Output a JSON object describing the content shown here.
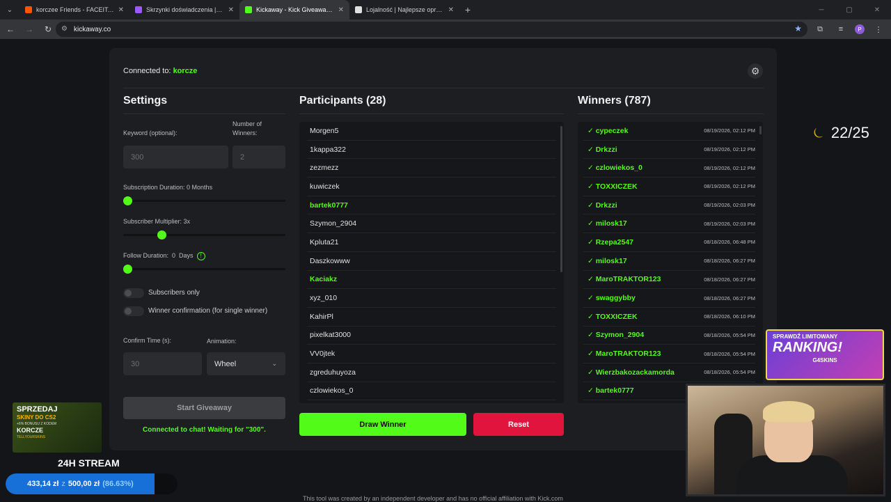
{
  "browser": {
    "tabs": [
      {
        "title": "korczee Friends - FACEIT.com",
        "color": "#ff5500",
        "active": false
      },
      {
        "title": "Skrzynki doświadczenia | G4Skins",
        "color": "#9b59ff",
        "active": false
      },
      {
        "title": "Kickaway - Kick Giveaway Tool",
        "color": "#53fc18",
        "active": true
      },
      {
        "title": "Lojalność | Najlepsze oprogram...",
        "color": "#e0e0e0",
        "active": false
      }
    ],
    "url": "kickaway.co",
    "profile_initial": "P"
  },
  "app": {
    "connected_label": "Connected to:",
    "connected_user": "korcze",
    "settings": {
      "title": "Settings",
      "keyword_label": "Keyword (optional):",
      "keyword_value": "300",
      "winners_label_1": "Number of",
      "winners_label_2": "Winners:",
      "winners_value": "2",
      "sub_duration_label": "Subscription Duration: 0 Months",
      "sub_duration_value": 0,
      "sub_multiplier_label": "Subscriber Multiplier: 3x",
      "sub_multiplier_value": 3,
      "follow_duration_label": "Follow Duration:  0  Days",
      "follow_duration_value": 0,
      "subscribers_only_label": "Subscribers only",
      "subscribers_only": false,
      "winner_confirm_label": "Winner confirmation (for single winner)",
      "winner_confirm": false,
      "confirm_time_label": "Confirm Time (s):",
      "confirm_time_value": "30",
      "animation_label": "Animation:",
      "animation_value": "Wheel",
      "start_label": "Start Giveaway",
      "status_text": "Connected to chat! Waiting for \"300\"."
    },
    "participants": {
      "title": "Participants (28)",
      "items": [
        {
          "name": "Morgen5",
          "hl": false
        },
        {
          "name": "1kappa322",
          "hl": false
        },
        {
          "name": "zezmezz",
          "hl": false
        },
        {
          "name": "kuwiczek",
          "hl": false
        },
        {
          "name": "bartek0777",
          "hl": true
        },
        {
          "name": "Szymon_2904",
          "hl": false
        },
        {
          "name": "Kpluta21",
          "hl": false
        },
        {
          "name": "Daszkowww",
          "hl": false
        },
        {
          "name": "Kaciakz",
          "hl": true
        },
        {
          "name": "xyz_010",
          "hl": false
        },
        {
          "name": "KahirPl",
          "hl": false
        },
        {
          "name": "pixelkat3000",
          "hl": false
        },
        {
          "name": "VV0jtek",
          "hl": false
        },
        {
          "name": "zgreduhuyoza",
          "hl": false
        },
        {
          "name": "czlowiekos_0",
          "hl": false
        }
      ],
      "draw_label": "Draw Winner",
      "reset_label": "Reset"
    },
    "winners": {
      "title": "Winners (787)",
      "items": [
        {
          "name": "✓ cypeczek",
          "date": "08/19/2026, 02:12 PM"
        },
        {
          "name": "✓ Drkzzi",
          "date": "08/19/2026, 02:12 PM"
        },
        {
          "name": "✓ czlowiekos_0",
          "date": "08/19/2026, 02:12 PM"
        },
        {
          "name": "✓ TOXXICZEK",
          "date": "08/19/2026, 02:12 PM"
        },
        {
          "name": "✓ Drkzzi",
          "date": "08/19/2026, 02:03 PM"
        },
        {
          "name": "✓ milosk17",
          "date": "08/19/2026, 02:03 PM"
        },
        {
          "name": "✓ Rzepa2547",
          "date": "08/18/2026, 06:48 PM"
        },
        {
          "name": "✓ milosk17",
          "date": "08/18/2026, 06:27 PM"
        },
        {
          "name": "✓ MaroTRAKTOR123",
          "date": "08/18/2026, 06:27 PM"
        },
        {
          "name": "✓ swaggybby",
          "date": "08/18/2026, 06:27 PM"
        },
        {
          "name": "✓ TOXXICZEK",
          "date": "08/18/2026, 06:10 PM"
        },
        {
          "name": "✓ Szymon_2904",
          "date": "08/18/2026, 05:54 PM"
        },
        {
          "name": "✓ MaroTRAKTOR123",
          "date": "08/18/2026, 05:54 PM"
        },
        {
          "name": "✓ Wierzbakozackamorda",
          "date": "08/18/2026, 05:54 PM"
        },
        {
          "name": "✓ bartek0777",
          "date": ""
        }
      ]
    },
    "footer": "This tool was created by an independent developer and has no official affiliation with Kick.com"
  },
  "overlay": {
    "sub_counter": "22/25",
    "promo": {
      "line1": "SPRZEDAJ",
      "line2": "SKINY DO CS2",
      "line3": "+6% BONUSU Z KODEM",
      "line4": "KORCZE",
      "line5": "TELLYOURSKINS"
    },
    "stream_label": "24H STREAM",
    "goal": {
      "current": "433,14 zł",
      "sep": "z",
      "target": "500,00 zł",
      "percent_text": "(86.63%)",
      "percent": 86.63
    },
    "ranking": {
      "line1": "SPRAWDŹ LIMITOWANY",
      "line2": "RANKING!",
      "line3": "G4SKINS"
    }
  },
  "colors": {
    "accent": "#53fc18",
    "danger": "#e0143c",
    "panel": "#1c1e21"
  }
}
